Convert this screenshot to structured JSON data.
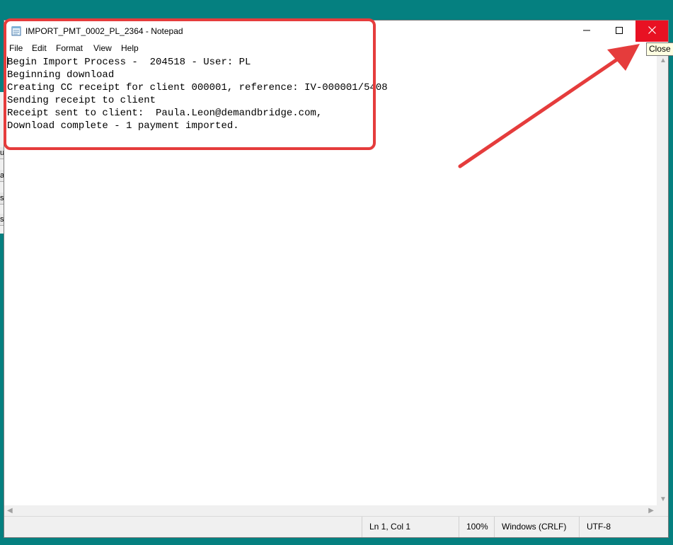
{
  "window": {
    "title": "IMPORT_PMT_0002_PL_2364 - Notepad",
    "close_tooltip": "Close"
  },
  "menu": {
    "items": [
      {
        "label": "File"
      },
      {
        "label": "Edit"
      },
      {
        "label": "Format"
      },
      {
        "label": "View"
      },
      {
        "label": "Help"
      }
    ]
  },
  "document": {
    "lines": [
      "Begin Import Process -  204518 - User: PL",
      "Beginning download",
      "Creating CC receipt for client 000001, reference: IV-000001/5408",
      "Sending receipt to client",
      "Receipt sent to client:  Paula.Leon@demandbridge.com,",
      "Download complete - 1 payment imported."
    ]
  },
  "status": {
    "position": "Ln 1, Col 1",
    "zoom": "100%",
    "line_ending": "Windows (CRLF)",
    "encoding": "UTF-8"
  },
  "background_window": {
    "fragments": [
      "u",
      "a",
      "s",
      "s"
    ]
  },
  "colors": {
    "desktop": "#058080",
    "close_button": "#e81123",
    "annotation": "#e53c3c",
    "tooltip_bg": "#ffffe1"
  },
  "icons": {
    "app": "notepad-icon",
    "minimize": "minimize-icon",
    "maximize": "maximize-icon",
    "close": "close-icon"
  }
}
